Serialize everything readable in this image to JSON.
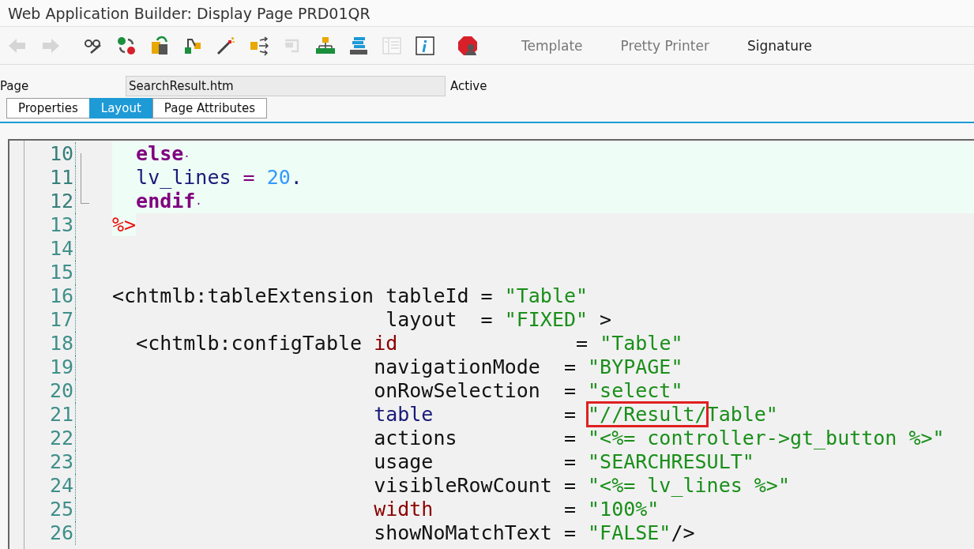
{
  "window": {
    "title": "Web Application Builder: Display Page PRD01QR"
  },
  "toolbar": {
    "icons": [
      {
        "kind": "back",
        "disabled": true
      },
      {
        "kind": "forward",
        "disabled": true
      },
      {
        "kind": "glasses",
        "disabled": false
      },
      {
        "kind": "swap",
        "disabled": false
      },
      {
        "kind": "copy",
        "disabled": false
      },
      {
        "kind": "hierarchy",
        "disabled": false
      },
      {
        "kind": "wand",
        "disabled": false
      },
      {
        "kind": "branch",
        "disabled": false
      },
      {
        "kind": "clip",
        "disabled": true
      },
      {
        "kind": "tree",
        "disabled": false
      },
      {
        "kind": "stack",
        "disabled": false
      },
      {
        "kind": "panel",
        "disabled": true
      },
      {
        "kind": "info",
        "disabled": false
      },
      {
        "kind": "stop",
        "disabled": false
      }
    ],
    "text_buttons": [
      "Template",
      "Pretty Printer",
      "Signature"
    ],
    "text_button_disabled": [
      true,
      true,
      false
    ]
  },
  "page_field": {
    "label": "Page",
    "value": "SearchResult.htm",
    "status": "Active"
  },
  "tabs": [
    {
      "label": "Properties",
      "selected": false
    },
    {
      "label": "Layout",
      "selected": true
    },
    {
      "label": "Page Attributes",
      "selected": false
    }
  ],
  "code": [
    {
      "number": "10",
      "block": true,
      "tokens": [
        {
          "kind": "keyword",
          "text": "  else"
        },
        {
          "kind": "dot",
          "text": "·"
        }
      ]
    },
    {
      "number": "11",
      "block": true,
      "tokens": [
        {
          "kind": "variable",
          "text": "  lv_lines"
        },
        {
          "kind": "operator",
          "text": " ="
        },
        {
          "kind": "number",
          "text": " 20"
        },
        {
          "kind": "variable",
          "text": "."
        }
      ]
    },
    {
      "number": "12",
      "block": true,
      "tokens": [
        {
          "kind": "keyword",
          "text": "  endif"
        },
        {
          "kind": "dot",
          "text": "·"
        }
      ]
    },
    {
      "number": "13",
      "block": false,
      "tokens": [
        {
          "kind": "delimiter",
          "text": "%>"
        }
      ]
    },
    {
      "number": "14",
      "block": false
    },
    {
      "number": "15",
      "block": false
    },
    {
      "number": "16",
      "block": false,
      "tokens": [
        {
          "kind": "tag",
          "text": "<chtmlb:tableExtension tableId = "
        },
        {
          "kind": "string",
          "text": "\"Table\""
        }
      ]
    },
    {
      "number": "17",
      "block": false,
      "tokens": [
        {
          "kind": "tag",
          "text": "                       layout  = "
        },
        {
          "kind": "string",
          "text": "\"FIXED\""
        },
        {
          "kind": "tag",
          "text": " >"
        }
      ]
    },
    {
      "number": "18",
      "block": false,
      "tokens": [
        {
          "kind": "tag",
          "text": "  <chtmlb:configTable "
        },
        {
          "kind": "keyattr",
          "text": "id"
        },
        {
          "kind": "tag",
          "text": "               = "
        },
        {
          "kind": "string",
          "text": "\"Table\""
        }
      ]
    },
    {
      "number": "19",
      "block": false,
      "tokens": [
        {
          "kind": "tag",
          "text": "                      navigationMode  = "
        },
        {
          "kind": "string",
          "text": "\"BYPAGE\""
        }
      ]
    },
    {
      "number": "20",
      "block": false,
      "tokens": [
        {
          "kind": "tag",
          "text": "                      onRowSelection  = "
        },
        {
          "kind": "string",
          "text": "\"select\""
        }
      ]
    },
    {
      "number": "21",
      "block": false,
      "tokens": [
        {
          "kind": "variable",
          "text": "                      table"
        },
        {
          "kind": "tag",
          "text": "           = "
        },
        {
          "kind": "string",
          "text": "\"//Result/",
          "highlighted": true
        },
        {
          "kind": "string",
          "text": "Table\""
        }
      ]
    },
    {
      "number": "22",
      "block": false,
      "tokens": [
        {
          "kind": "tag",
          "text": "                      actions         = "
        },
        {
          "kind": "string",
          "text": "\"<%= controller->gt_button %>\""
        }
      ]
    },
    {
      "number": "23",
      "block": false,
      "tokens": [
        {
          "kind": "tag",
          "text": "                      usage           = "
        },
        {
          "kind": "string",
          "text": "\"SEARCHRESULT\""
        }
      ]
    },
    {
      "number": "24",
      "block": false,
      "tokens": [
        {
          "kind": "tag",
          "text": "                      visibleRowCount = "
        },
        {
          "kind": "string",
          "text": "\"<%= lv_lines %>\""
        }
      ]
    },
    {
      "number": "25",
      "block": false,
      "tokens": [
        {
          "kind": "keyattr",
          "text": "                      width"
        },
        {
          "kind": "tag",
          "text": "           = "
        },
        {
          "kind": "string",
          "text": "\"100%\""
        }
      ]
    },
    {
      "number": "26",
      "block": false,
      "tokens": [
        {
          "kind": "tag",
          "text": "                      showNoMatchText = "
        },
        {
          "kind": "string",
          "text": "\"FALSE\""
        },
        {
          "kind": "tag",
          "text": "/>"
        }
      ]
    }
  ]
}
